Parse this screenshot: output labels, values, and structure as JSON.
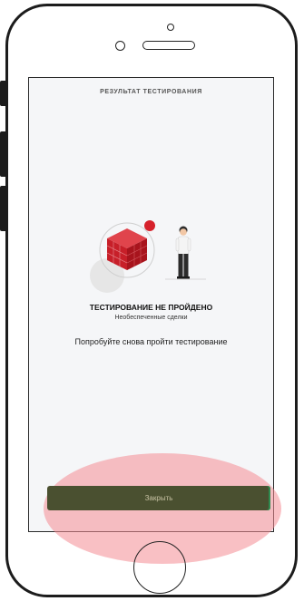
{
  "screen": {
    "title": "РЕЗУЛЬТАТ ТЕСТИРОВАНИЯ",
    "result_title": "ТЕСТИРОВАНИЕ НЕ ПРОЙДЕНО",
    "result_subtitle": "Необеспеченные сделки",
    "result_message": "Попробуйте снова пройти тестирование",
    "close_button_label": "Закрыть"
  },
  "colors": {
    "accent_red": "#d6212b",
    "button_bg": "#4a5030",
    "button_text": "#c9c3a4",
    "highlight": "#f48c94"
  },
  "icons": [
    "camera-icon",
    "sensor-icon",
    "speaker-icon",
    "cube-icon",
    "person-icon",
    "home-button"
  ]
}
